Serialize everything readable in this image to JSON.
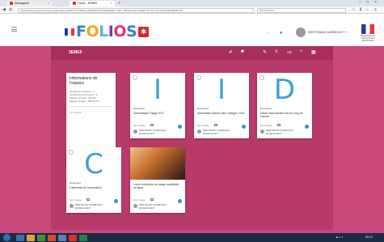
{
  "browser": {
    "tabs": [
      {
        "label": "Messagerie",
        "color": "#d93025"
      },
      {
        "label": "Folios - 3EME5",
        "color": "#d93025"
      }
    ],
    "url": "https://folios.onisep.fr/dd-cart-ent/pro/folio.pl/d/idos/?CORRIG_IDENTIFICATION&DIRECTORY_DETAILS&FOLDER_ID=32_FOLIOUNLIMITEDDETAIL",
    "search_placeholder": "Rechercher"
  },
  "header": {
    "logo": [
      "F",
      "O",
      "L",
      "I",
      "O",
      "S"
    ],
    "logo_colors": [
      "#3d7fc1",
      "#f4a81d",
      "#5bb5d6",
      "#7a3c9c",
      "#e5336b",
      "#3d7fc1"
    ],
    "user_name": "BERTRAND DARBOUET",
    "edu_label": "MINISTÈRE DE L'ÉDUCATION NATIONALE"
  },
  "folder": {
    "title": "3EME5"
  },
  "toolbar_icons": [
    "check-circle-icon",
    "folder-icon",
    "pen-icon",
    "sort-icon",
    "text-size-icon",
    "add-icon",
    "grid-icon"
  ],
  "info_panel": {
    "title": "Informations de l'espace",
    "lines": [
      "Nombre de dossiers : 0",
      "Nombre de documents : 6",
      "Espace occupé : 110 Mo",
      "Espace restant : 485.00 Mo"
    ],
    "link": "En savoir"
  },
  "cards": [
    {
      "letter": "I",
      "color": "#3d9fd8",
      "type": "Document",
      "name": "Informatique Stage 2017",
      "meta": "Non classé",
      "owner": "BERTRAND DARBOUET",
      "owner_sub": "ENSEIGNANT"
    },
    {
      "letter": "I",
      "color": "#3d9fd8",
      "type": "Document",
      "name": "Information Brevet des Collèges 2016",
      "meta": "Non classé",
      "owner": "BERTRAND DARBOUET",
      "owner_sub": "ENSEIGNANT"
    },
    {
      "letter": "D",
      "color": "#3d9fd8",
      "type": "Document",
      "name": "Dates importantes tout au long de l'année",
      "meta": "Non classé",
      "owner": "BERTRAND DARBOUET",
      "owner_sub": "ENSEIGNANT"
    },
    {
      "letter": "C",
      "color": "#3d9fd8",
      "type": "Document",
      "name": "Calendrier de l'orientation",
      "meta": "Non classé",
      "owner": "BERTRAND DARBOUET",
      "owner_sub": "ENSEIGNANT"
    },
    {
      "letter": "",
      "color": "#3d9fd8",
      "type": "",
      "name": "Livret recherche de stage modifiable en ligne",
      "meta": "Non classé",
      "owner": "BERTRAND DARBOUET",
      "owner_sub": "ENSEIGNANT"
    }
  ],
  "taskbar": {
    "apps": [
      "#3a6fb0",
      "#e2a23b",
      "#4a8f3a",
      "#d64a2d",
      "#5b7fb8",
      "#d93025",
      "#2c7d4f"
    ],
    "time": "09:12"
  }
}
